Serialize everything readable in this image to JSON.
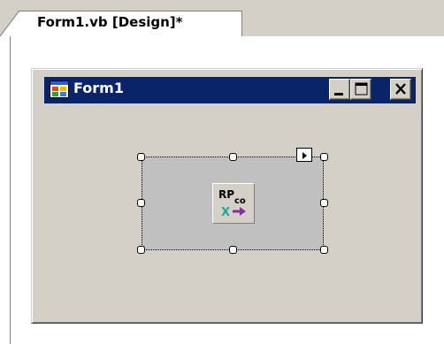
{
  "document_tab": {
    "label": "Form1.vb [Design]*"
  },
  "form": {
    "title": "Form1",
    "icon": "form-icon",
    "caption_buttons": [
      {
        "name": "minimize",
        "icon": "minimize-icon"
      },
      {
        "name": "maximize",
        "icon": "maximize-icon"
      },
      {
        "name": "close",
        "icon": "close-icon"
      }
    ]
  },
  "component": {
    "icon": "report-component-icon",
    "icon_text": "RPco",
    "smart_tag_icon": "smart-tag-arrow-icon"
  },
  "colors": {
    "title_bar": "#0a246a",
    "form_background": "#d4d0c8",
    "component_background": "#c0c0c0",
    "tabstrip_background": "#d4d0c8"
  }
}
